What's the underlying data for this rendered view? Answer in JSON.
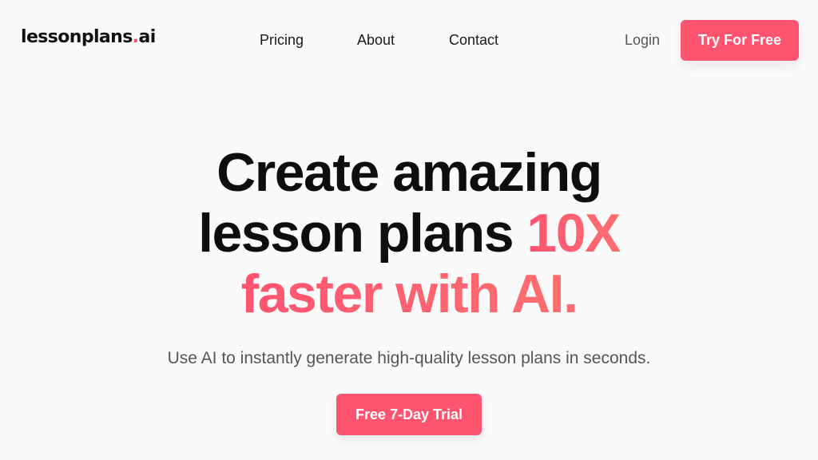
{
  "header": {
    "logo": {
      "text_main": "lessonplans",
      "text_dot": ".",
      "text_tld": "ai"
    },
    "nav": [
      {
        "label": "Pricing"
      },
      {
        "label": "About"
      },
      {
        "label": "Contact"
      }
    ],
    "login_label": "Login",
    "cta_label": "Try For Free"
  },
  "hero": {
    "title_line1": "Create amazing",
    "title_line2_plain": "lesson plans ",
    "title_line2_accent": "10X",
    "title_line3_accent": "faster with AI.",
    "subtitle": "Use AI to instantly generate high-quality lesson plans in seconds.",
    "cta_label": "Free 7-Day Trial"
  },
  "colors": {
    "brand": "#ff5470",
    "accent_gradient_end": "#ff6f6f",
    "text_dark": "#0e0e0e",
    "text_muted": "#555555",
    "background": "#fafafa"
  }
}
